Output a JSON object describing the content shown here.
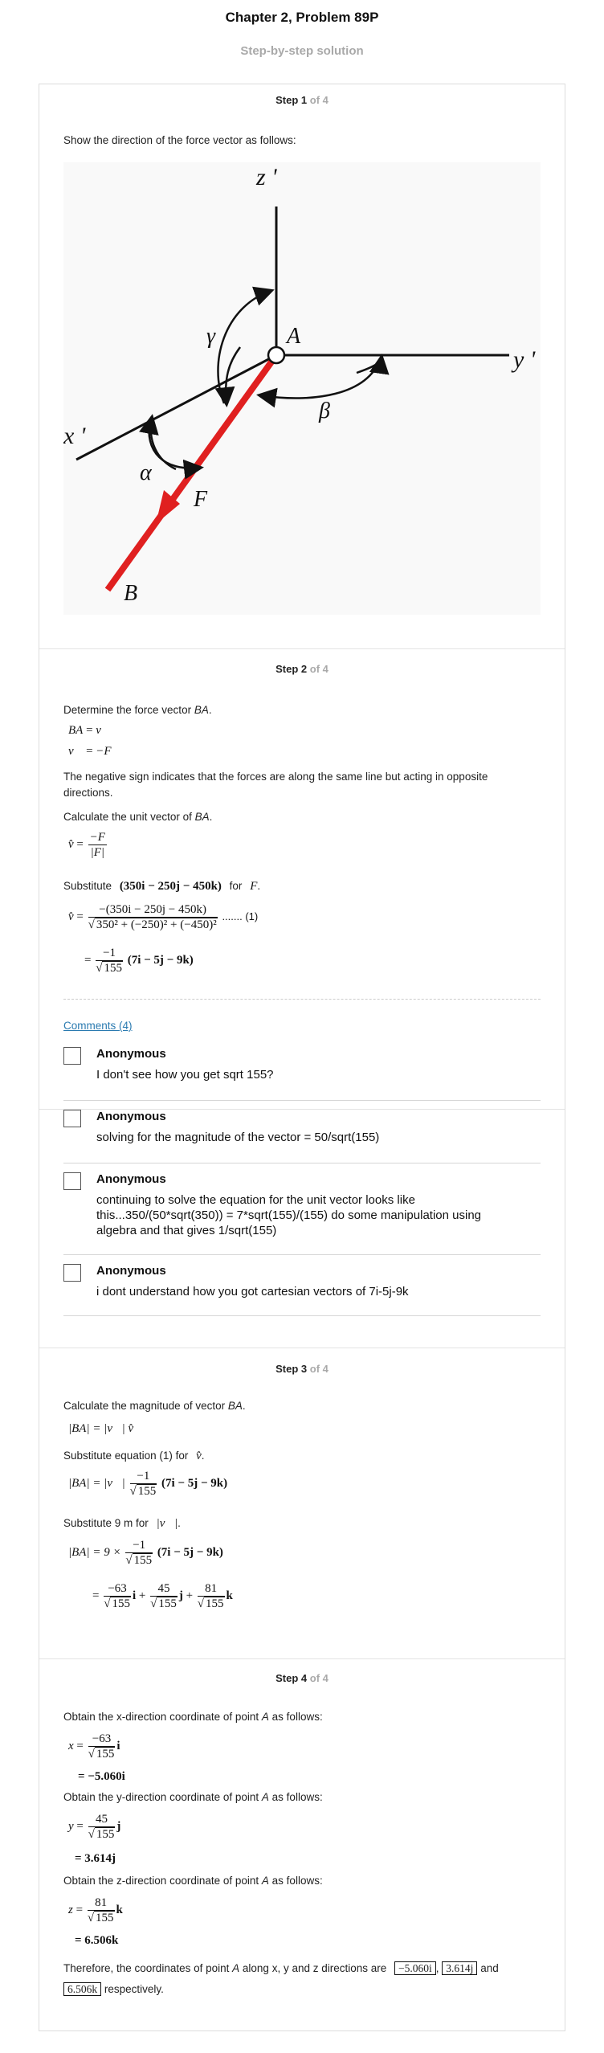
{
  "header": {
    "title": "Chapter 2, Problem 89P",
    "subtitle": "Step-by-step solution"
  },
  "steps": [
    {
      "label": "Step 1",
      "of": "of 4",
      "text": "Show the direction of the force vector as follows:",
      "diagram": {
        "labels": {
          "z": "z '",
          "y": "y '",
          "x": "x '",
          "A": "A",
          "B": "B",
          "F": "F",
          "alpha": "α",
          "beta": "β",
          "gamma": "γ"
        },
        "colors": {
          "force": "#e02020",
          "axis": "#111111"
        }
      }
    },
    {
      "label": "Step 2",
      "of": "of 4",
      "intro": "Determine the force vector ",
      "intro_var": "BA",
      "intro_end": ".",
      "eq1_lhs": "BA",
      "eq1_rhs": "v⃗",
      "eq2_lhs": "v⃗",
      "eq2_rhs": "−F",
      "note": "The negative sign indicates that the forces are along the same line but acting in opposite directions.",
      "unit_intro": "Calculate the unit vector of ",
      "unit_var": "BA",
      "unit_end": ".",
      "unit_eq": {
        "lhs": "v̂",
        "num": "−F",
        "den": "|F|"
      },
      "subst": {
        "prefix": "Substitute",
        "expr": "(350i − 250j − 450k)",
        "for": "for",
        "var": "F",
        "end": "."
      },
      "eq_mag": {
        "lhs": "v̂",
        "num": "−(350i − 250j − 450k)",
        "den": "350² + (−250)² + (−450)²",
        "ref": "....... (1)"
      },
      "eq_simpl": {
        "num": "−1",
        "den": "155",
        "tail": "(7i − 5j − 9k)"
      },
      "comments_link": "Comments (4)",
      "comments": [
        {
          "author": "Anonymous",
          "text": "I don't see how you get sqrt 155?"
        },
        {
          "author": "Anonymous",
          "text": "solving for the magnitude of the vector = 50/sqrt(155)"
        },
        {
          "author": "Anonymous",
          "text": "continuing to solve the equation for the unit vector looks like this...350/(50*sqrt(350)) = 7*sqrt(155)/(155) do some manipulation using algebra and that gives 1/sqrt(155)"
        },
        {
          "author": "Anonymous",
          "text": "i dont understand how you got cartesian vectors of 7i-5j-9k"
        }
      ]
    },
    {
      "label": "Step 3",
      "of": "of 4",
      "intro": "Calculate the magnitude of vector ",
      "intro_var": "BA",
      "intro_end": ".",
      "eq1": "|BA| = |v⃗| v̂",
      "subst1_prefix": "Substitute equation (1) for",
      "subst1_var": "v̂",
      "subst1_end": ".",
      "eq2": {
        "lhs": "|BA| = |v⃗|",
        "num": "−1",
        "den": "155",
        "tail": "(7i − 5j − 9k)"
      },
      "subst2_prefix": "Substitute 9 m for",
      "subst2_var": "|v⃗|",
      "subst2_end": ".",
      "eq3": {
        "lhs": "|BA| = 9 ×",
        "num": "−1",
        "den": "155",
        "tail": "(7i − 5j − 9k)"
      },
      "eq4": {
        "t1n": "−63",
        "t1d": "155",
        "t1u": "i",
        "t2n": "45",
        "t2d": "155",
        "t2u": "j",
        "t3n": "81",
        "t3d": "155",
        "t3u": "k"
      }
    },
    {
      "label": "Step 4",
      "of": "of 4",
      "x_intro": "Obtain the x-direction coordinate of point ",
      "y_intro": "Obtain the y-direction coordinate of point ",
      "z_intro": "Obtain the z-direction coordinate of point ",
      "point": "A",
      "tail": " as follows:",
      "x": {
        "lhs": "x",
        "num": "−63",
        "den": "155",
        "unit": "i",
        "result": "= −5.060i"
      },
      "y": {
        "lhs": "y",
        "num": "45",
        "den": "155",
        "unit": "j",
        "result": "= 3.614j"
      },
      "z": {
        "lhs": "z",
        "num": "81",
        "den": "155",
        "unit": "k",
        "result": "= 6.506k"
      },
      "conclusion_pre": "Therefore, the coordinates of point ",
      "conclusion_mid": " along x, y and z directions are",
      "ans_x": "−5.060i",
      "ans_y": "3.614j",
      "and": "and",
      "ans_z": "6.506k",
      "respectively": "respectively."
    }
  ]
}
